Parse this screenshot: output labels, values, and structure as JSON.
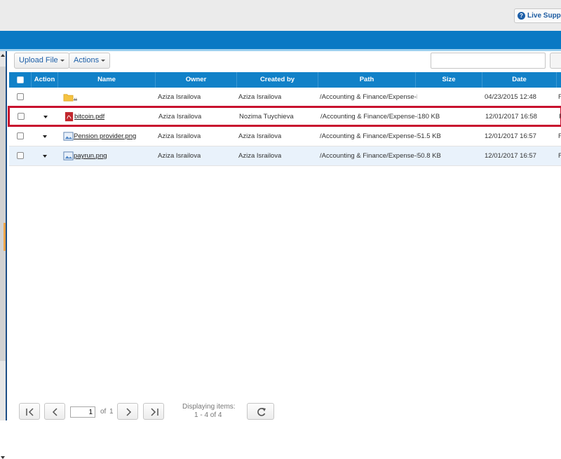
{
  "header": {
    "live_support_label": "Live Support"
  },
  "toolbar": {
    "upload_file_label": "Upload File",
    "actions_label": "Actions",
    "search_value": ""
  },
  "grid": {
    "columns": [
      "Action",
      "Name",
      "Owner",
      "Created by",
      "Path",
      "Size",
      "Date"
    ],
    "rows": [
      {
        "name": "..",
        "owner": "Aziza Israilova",
        "created_by": "Aziza Israilova",
        "path": "/Accounting & Finance/Expense-I",
        "size": "",
        "date": "04/23/2015 12:48",
        "extra": "F",
        "icon": "folder-icon"
      },
      {
        "name": "bitcoin.pdf",
        "owner": "Aziza Israilova",
        "created_by": "Nozima Tuychieva",
        "path": "/Accounting & Finance/Expense-I",
        "size": "180 KB",
        "date": "12/01/2017 16:58",
        "extra": "F",
        "icon": "pdf-icon"
      },
      {
        "name": "Pension provider.png",
        "owner": "Aziza Israilova",
        "created_by": "Aziza Israilova",
        "path": "/Accounting & Finance/Expense-I",
        "size": "51.5 KB",
        "date": "12/01/2017 16:57",
        "extra": "F",
        "icon": "image-file-icon"
      },
      {
        "name": "payrun.png",
        "owner": "Aziza Israilova",
        "created_by": "Aziza Israilova",
        "path": "/Accounting & Finance/Expense-I",
        "size": "50.8 KB",
        "date": "12/01/2017 16:57",
        "extra": "F",
        "icon": "image-file-icon"
      }
    ]
  },
  "pager": {
    "page_value": "1",
    "of_label": "of",
    "total_pages": "1",
    "displaying_label": "Displaying items:",
    "displaying_range": "1 - 4 of 4"
  },
  "colors": {
    "header_blue": "#1181c8",
    "top_blue": "#0a79c4",
    "selection_red": "#c8102e"
  }
}
